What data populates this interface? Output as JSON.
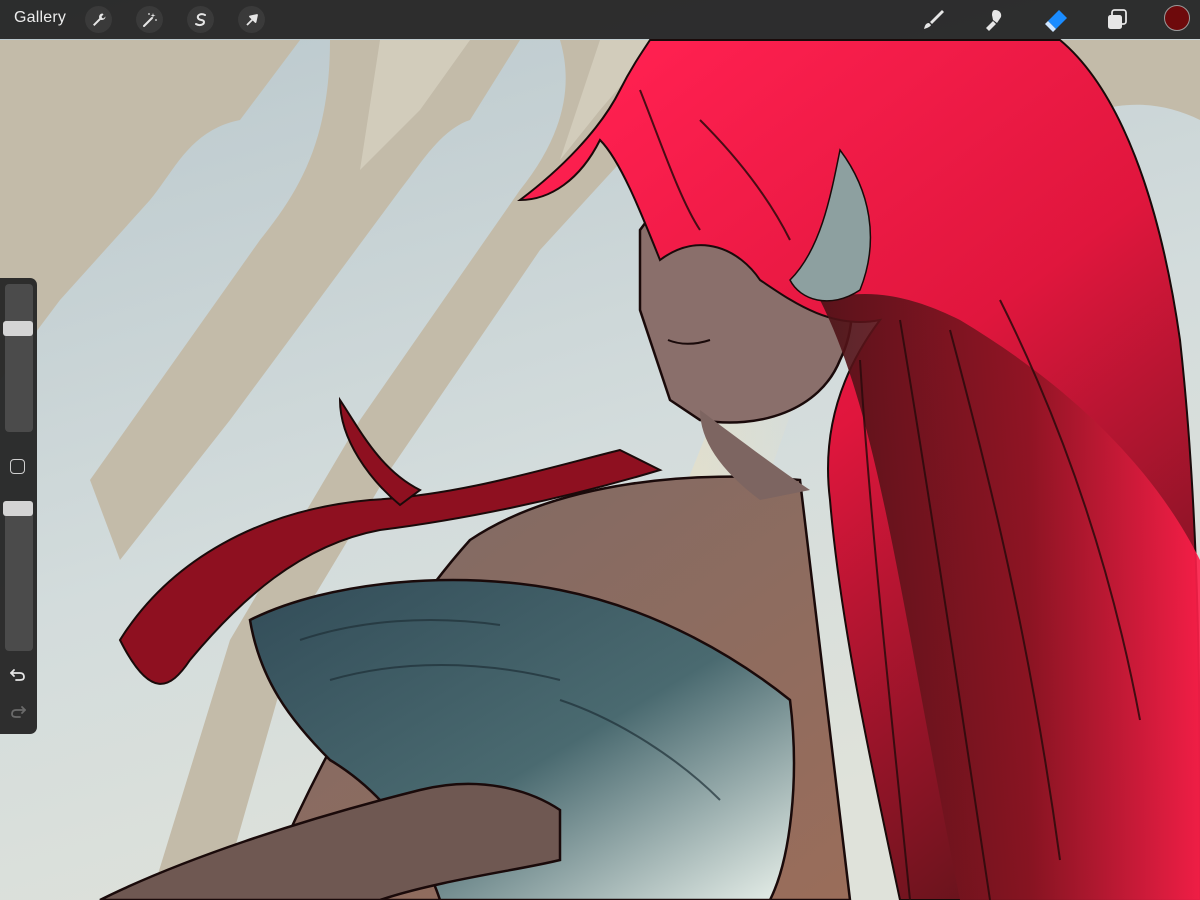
{
  "app": {
    "gallery_label": "Gallery"
  },
  "toolbar": {
    "left_actions": [
      {
        "name": "actions",
        "icon": "wrench-icon"
      },
      {
        "name": "adjustments",
        "icon": "magic-wand-icon"
      },
      {
        "name": "selection",
        "icon": "selection-s-icon"
      },
      {
        "name": "transform",
        "icon": "arrow-cursor-icon"
      }
    ],
    "right_tools": [
      {
        "name": "brush",
        "icon": "brush-icon",
        "active": false
      },
      {
        "name": "smudge",
        "icon": "smudge-icon",
        "active": false
      },
      {
        "name": "eraser",
        "icon": "eraser-icon",
        "active": true
      },
      {
        "name": "layers",
        "icon": "layers-icon",
        "active": false
      }
    ],
    "current_color": "#6e0a0c",
    "active_tool_color": "#1a8cff"
  },
  "sidebar": {
    "brush_size_level": 0.72,
    "opacity_level": 1.0,
    "buttons": [
      "modify-button",
      "undo-button",
      "redo-button"
    ]
  },
  "artwork": {
    "palette": {
      "sky": "#c9d6d9",
      "window_frame": "#c7bfae",
      "hair_highlight": "#ff1f4a",
      "hair_shadow": "#4a1216",
      "skin": "#8a6a5e",
      "cloth": "#3f5a62",
      "cloth_light": "#e6efe8",
      "eye": "#30d0a8"
    }
  }
}
